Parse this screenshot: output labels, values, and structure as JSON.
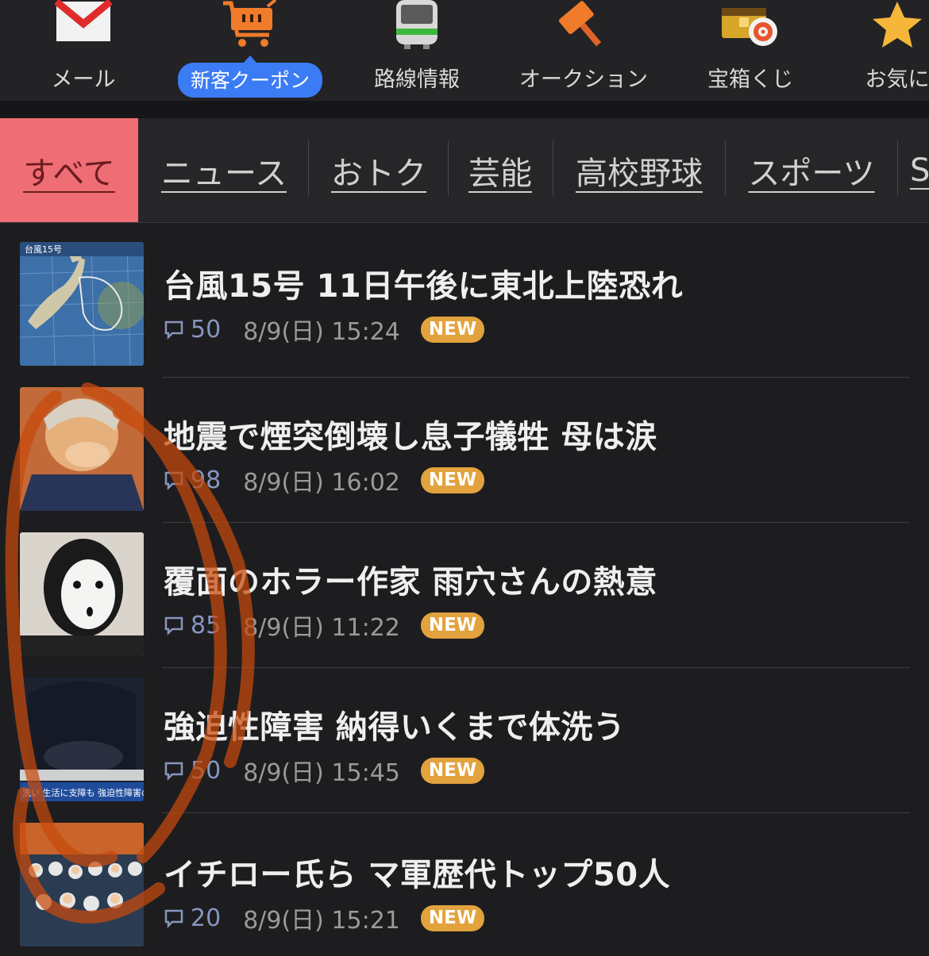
{
  "apps": [
    {
      "label": "メール",
      "icon": "mail-icon"
    },
    {
      "label": "新客クーポン",
      "icon": "cart-icon",
      "highlight": true
    },
    {
      "label": "路線情報",
      "icon": "train-icon"
    },
    {
      "label": "オークション",
      "icon": "gavel-icon"
    },
    {
      "label": "宝箱くじ",
      "icon": "treasure-chest-icon"
    },
    {
      "label": "お気に",
      "icon": "star-icon"
    }
  ],
  "tabs": [
    {
      "label": "すべて",
      "active": true
    },
    {
      "label": "ニュース"
    },
    {
      "label": "おトク"
    },
    {
      "label": "芸能"
    },
    {
      "label": "高校野球"
    },
    {
      "label": "スポーツ"
    },
    {
      "label": "S"
    }
  ],
  "articles": [
    {
      "title": "台風15号 11日午後に東北上陸恐れ",
      "comments": "50",
      "date": "8/9(日) 15:24",
      "badge": "NEW",
      "thumb_caption": "台風15号",
      "thumb": "typhoon-map"
    },
    {
      "title": "地震で煙突倒壊し息子犠牲 母は涙",
      "comments": "98",
      "date": "8/9(日) 16:02",
      "badge": "NEW",
      "thumb": "grieving-mother"
    },
    {
      "title": "覆面のホラー作家 雨穴さんの熱意",
      "comments": "85",
      "date": "8/9(日) 11:22",
      "badge": "NEW",
      "thumb": "masked-writer"
    },
    {
      "title": "強迫性障害 納得いくまで体洗う",
      "comments": "50",
      "date": "8/9(日) 15:45",
      "badge": "NEW",
      "thumb": "news-broadcast",
      "thumb_caption": "洗い 生活に支障も 強迫性障害の"
    },
    {
      "title": "イチロー氏ら マ軍歴代トップ50人",
      "comments": "20",
      "date": "8/9(日) 15:21",
      "badge": "NEW",
      "thumb": "baseball-team"
    }
  ],
  "colors": {
    "background": "#1d1d1f",
    "active_tab": "#ef6d74",
    "badge": "#e2a23e",
    "coupon_pill": "#3b7cf5",
    "comment_count": "#8795c0",
    "scribble": "#c84a0c"
  }
}
